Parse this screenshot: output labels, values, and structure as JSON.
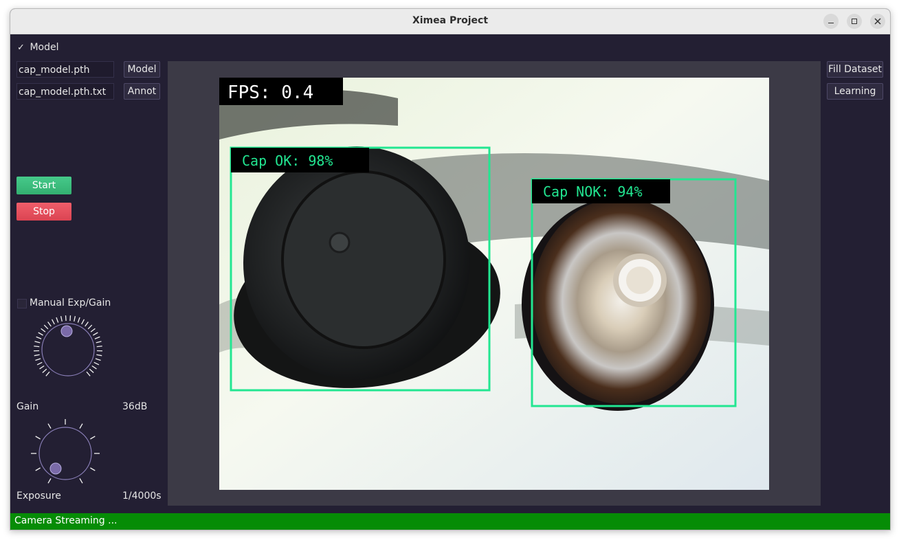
{
  "window": {
    "title": "Ximea Project"
  },
  "controls": {
    "model_checkbox_label": "Model",
    "model_checked_mark": "✓",
    "model_path": "cap_model.pth",
    "model_button": "Model",
    "annot_path": "cap_model.pth.txt",
    "annot_button": "Annot",
    "start_button": "Start",
    "stop_button": "Stop",
    "manual_exp_gain_label": "Manual Exp/Gain",
    "manual_exp_gain_checked": false
  },
  "gain": {
    "label": "Gain",
    "value": "36dB"
  },
  "exposure": {
    "label": "Exposure",
    "value": "1/4000s"
  },
  "right_panel": {
    "fill_dataset_button": "Fill Dataset",
    "learning_button": "Learning"
  },
  "view": {
    "fps_label": "FPS: 0.4",
    "detections": [
      {
        "label": "Cap OK: 98%"
      },
      {
        "label": "Cap NOK: 94%"
      }
    ],
    "box_color": "#22e691"
  },
  "status": {
    "text": "Camera Streaming ..."
  },
  "colors": {
    "start": "#3dbd7d",
    "stop": "#e54c59",
    "status_bar": "#068c06",
    "accent_dial": "#7a6aa8"
  }
}
